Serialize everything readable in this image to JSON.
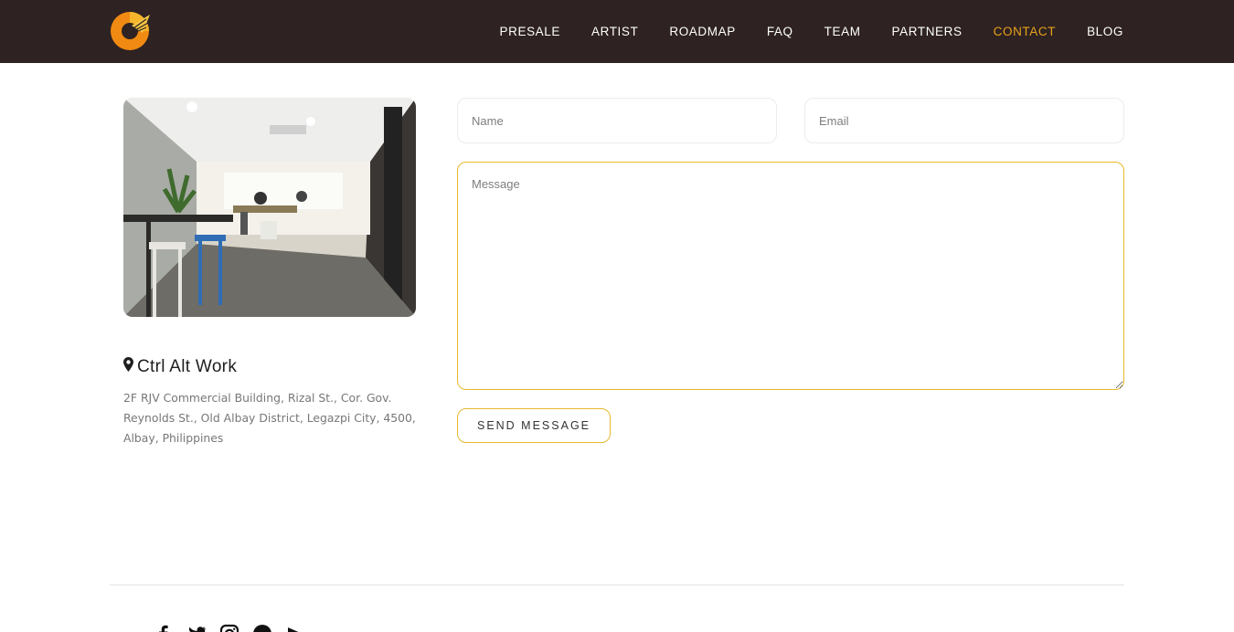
{
  "brand": {
    "logo_icon": "logo-icon",
    "accent": "#e8a21c",
    "header_bg": "#2e2222"
  },
  "nav": {
    "items": [
      {
        "label": "PRESALE"
      },
      {
        "label": "ARTIST"
      },
      {
        "label": "ROADMAP"
      },
      {
        "label": "FAQ"
      },
      {
        "label": "TEAM"
      },
      {
        "label": "PARTNERS"
      },
      {
        "label": "CONTACT",
        "active": true
      },
      {
        "label": "BLOG"
      }
    ]
  },
  "location": {
    "icon": "map-marker-icon",
    "title": "Ctrl Alt Work",
    "address": "2F RJV Commercial Building, Rizal St., Cor. Gov. Reynolds St., Old Albay District, Legazpi City, 4500, Albay, Philippines"
  },
  "form": {
    "name_placeholder": "Name",
    "email_placeholder": "Email",
    "message_placeholder": "Message",
    "submit_label": "SEND MESSAGE"
  },
  "footer": {
    "social_icons": [
      "facebook-icon",
      "twitter-icon",
      "instagram-icon",
      "discord-icon",
      "youtube-icon"
    ]
  }
}
